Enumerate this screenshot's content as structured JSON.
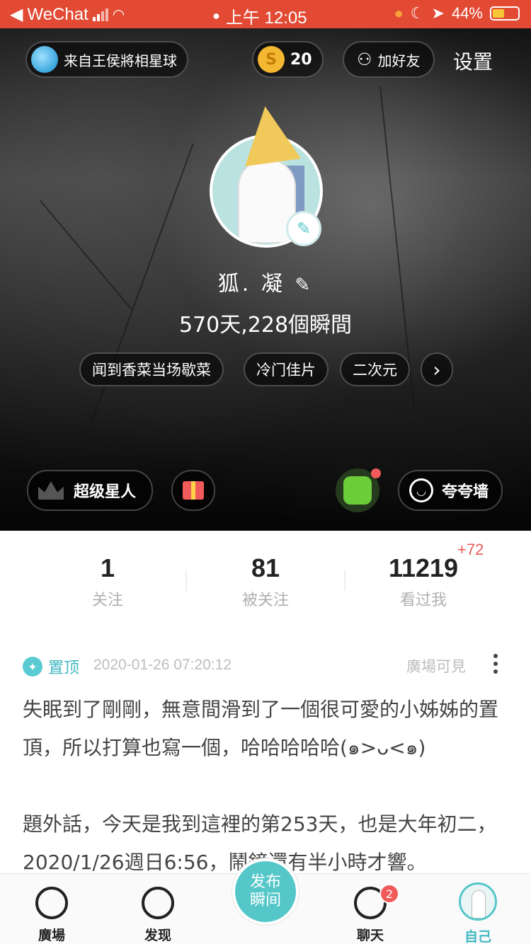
{
  "status_bar": {
    "back_app": "WeChat",
    "time": "上午 12:05",
    "battery": "44%"
  },
  "header": {
    "planet_label": "来自王侯將相星球",
    "coins": "20",
    "coin_symbol": "S",
    "add_friend": "加好友",
    "settings": "设置"
  },
  "profile": {
    "nickname": "狐. 凝",
    "summary": "570天,228個瞬間",
    "tags": [
      "闻到香菜当场歇菜",
      "冷门佳片",
      "二次元"
    ],
    "next_glyph": "›"
  },
  "actions": {
    "superstar": "超级星人",
    "praise_wall": "夸夸墙"
  },
  "stats": {
    "following_count": "1",
    "following_label": "关注",
    "followers_count": "81",
    "followers_label": "被关注",
    "views_count": "11219",
    "views_label": "看过我",
    "views_delta": "+72"
  },
  "post": {
    "pinned_label": "置顶",
    "date": "2020-01-26 07:20:12",
    "visibility": "廣場可見",
    "text": "失眠到了剛剛，無意間滑到了一個很可愛的小姊姊的置頂，所以打算也寫一個，哈哈哈哈哈(๑>ᴗ<๑)\n\n題外話，今天是我到這裡的第253天，也是大年初二，2020/1/26週日6:56，鬧鐘還有半小時才響。"
  },
  "tabbar": {
    "square": "廣場",
    "discover": "发现",
    "publish": "发布\n瞬间",
    "chat": "聊天",
    "chat_badge": "2",
    "me": "自己"
  },
  "colors": {
    "status_bar": "#e24a34",
    "accent": "#56c7c9",
    "badge": "#f05a5a"
  }
}
